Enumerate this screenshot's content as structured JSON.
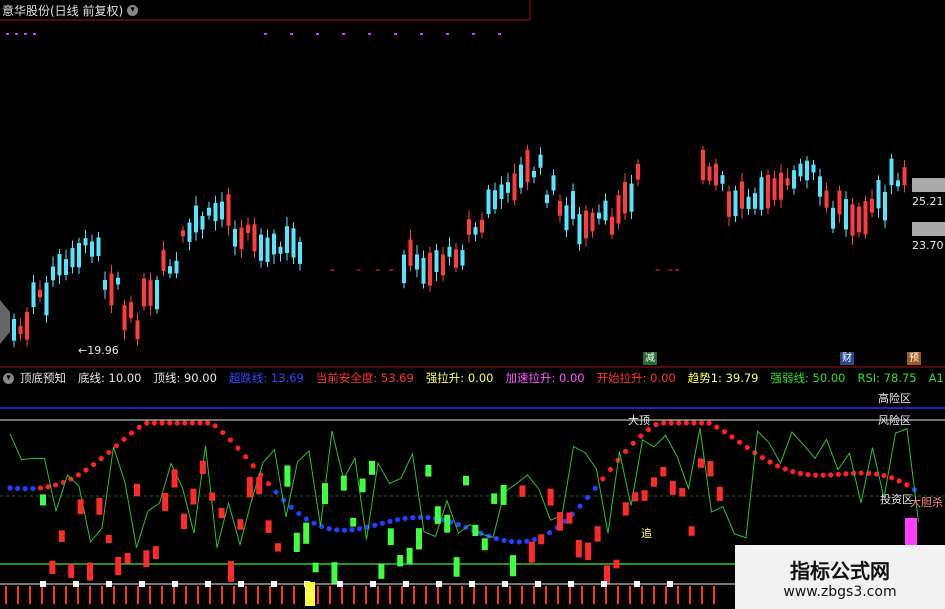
{
  "price_panel": {
    "title": "意华股份(日线 前复权)",
    "title_icon": "chevron-down-icon",
    "low_label": "←19.96",
    "price_tags": [
      "25.21",
      "23.70"
    ],
    "event_markers": [
      "减",
      "财",
      "预"
    ]
  },
  "indicator_panel": {
    "name": "顶底预知",
    "params": [
      {
        "label": "底线:",
        "value": "10.00",
        "color": "#e6e6e6"
      },
      {
        "label": "顶线:",
        "value": "90.00",
        "color": "#e6e6e6"
      },
      {
        "label": "超跌线:",
        "value": "13.69",
        "color": "#3344ff"
      },
      {
        "label": "当前安全度:",
        "value": "53.69",
        "color": "#ff3333"
      },
      {
        "label": "强拉升:",
        "value": "0.00",
        "color": "#ffff55"
      },
      {
        "label": "加速拉升:",
        "value": "0.00",
        "color": "#ff55ff"
      },
      {
        "label": "开始拉升:",
        "value": "0.00",
        "color": "#ff3333"
      },
      {
        "label": "趋势1:",
        "value": "39.79",
        "color": "#ffff55"
      },
      {
        "label": "强弱线:",
        "value": "50.00",
        "color": "#33dd33"
      },
      {
        "label": "RSI:",
        "value": "78.75",
        "color": "#33dd33"
      },
      {
        "label": "A1",
        "value": "",
        "color": "#33dd33"
      }
    ],
    "zone_labels": {
      "high_risk": "高险区",
      "risk": "风险区",
      "buy_zone": "投资区",
      "peak": "大顶",
      "chase": "追",
      "kill": "大胆杀"
    }
  },
  "colors": {
    "up": "#ff3b3b",
    "down": "#55e6ff",
    "bg": "#000000",
    "rsi": "#2ec02e",
    "dots_high": "#ff2020",
    "dots_low": "#2040ff"
  },
  "watermark": {
    "title": "指标公式网",
    "url": "www.zbgs3.com"
  }
}
